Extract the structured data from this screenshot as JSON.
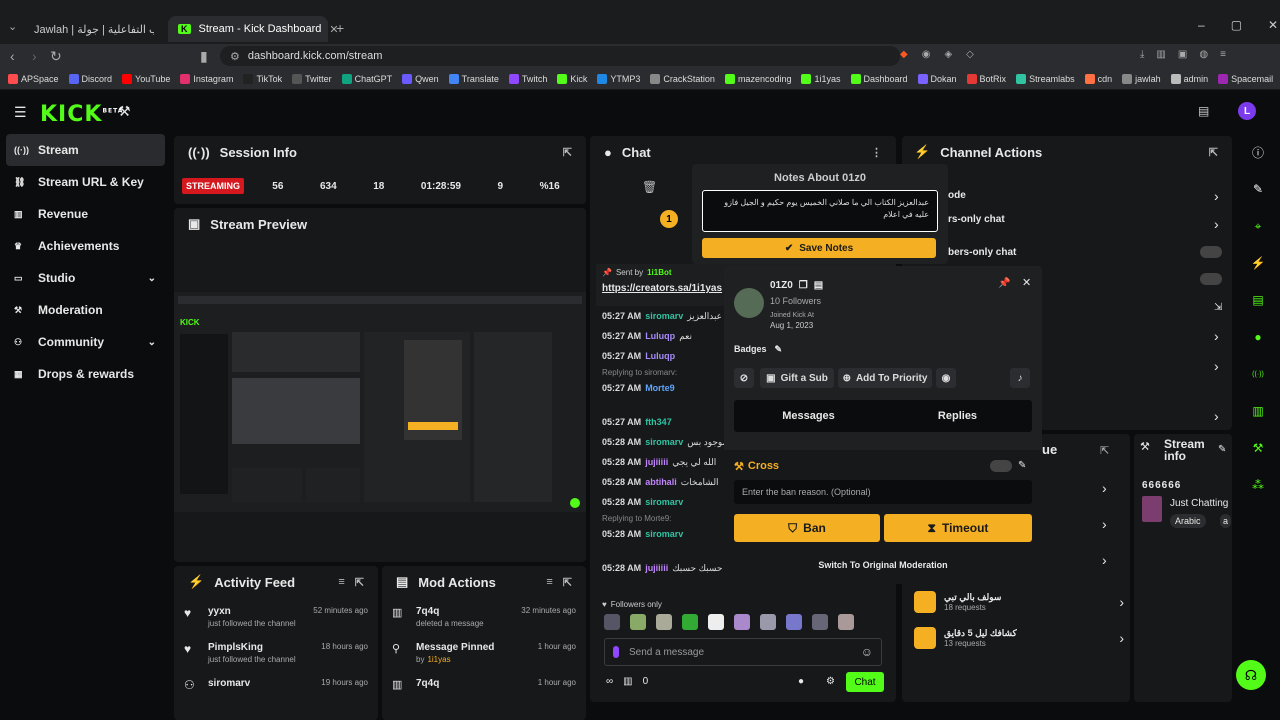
{
  "browser": {
    "tabs": [
      {
        "label": "Jawlah | منصة الألعاب التفاعلية | جولة"
      },
      {
        "label": "Stream - Kick Dashboard"
      }
    ],
    "url": "dashboard.kick.com/stream",
    "bookmarks": [
      "APSpace",
      "Discord",
      "YouTube",
      "Instagram",
      "TikTok",
      "Twitter",
      "ChatGPT",
      "Qwen",
      "Translate",
      "Twitch",
      "Kick",
      "YTMP3",
      "CrackStation",
      "mazencoding",
      "1i1yas",
      "Dashboard",
      "Dokan",
      "BotRix",
      "Streamlabs",
      "cdn",
      "jawlah",
      "admin",
      "Spacemail"
    ],
    "bookmark_colors": [
      "#ff4d4d",
      "#5865f2",
      "#ff0000",
      "#e1306c",
      "#222",
      "#555",
      "#10a37f",
      "#6b5bff",
      "#4285f4",
      "#9146ff",
      "#53fc18",
      "#1e88e5",
      "#888",
      "#53fc18",
      "#53fc18",
      "#53fc18",
      "#7b61ff",
      "#e53935",
      "#31c3a2",
      "#ff7043",
      "#888",
      "#bbb",
      "#9c27b0"
    ]
  },
  "app": {
    "logo": "KICK",
    "logo_sup": "BETA"
  },
  "sidebar": {
    "items": [
      {
        "label": "Stream",
        "icon": "broadcast-icon"
      },
      {
        "label": "Stream URL & Key",
        "icon": "link-icon"
      },
      {
        "label": "Revenue",
        "icon": "chart-icon"
      },
      {
        "label": "Achievements",
        "icon": "trophy-icon"
      },
      {
        "label": "Studio",
        "icon": "tv-icon"
      },
      {
        "label": "Moderation",
        "icon": "hammer-icon"
      },
      {
        "label": "Community",
        "icon": "people-icon"
      },
      {
        "label": "Drops & rewards",
        "icon": "gift-icon"
      }
    ]
  },
  "session": {
    "title": "Session Info",
    "status": "STREAMING",
    "stats": [
      "56",
      "634",
      "18",
      "01:28:59",
      "9",
      "%16"
    ]
  },
  "preview": {
    "title": "Stream Preview"
  },
  "activity": {
    "title": "Activity Feed",
    "items": [
      {
        "user": "yyxn",
        "text": "just followed the channel",
        "time": "52 minutes ago"
      },
      {
        "user": "PimplsKing",
        "text": "just followed the channel",
        "time": "18 hours ago"
      },
      {
        "user": "siromarv",
        "text": "",
        "time": "19 hours ago"
      }
    ]
  },
  "modactions": {
    "title": "Mod Actions",
    "items": [
      {
        "user": "7q4q",
        "text": "deleted a message",
        "time": "32 minutes ago"
      },
      {
        "user": "Message Pinned",
        "by": "by",
        "who": "1i1yas",
        "time": "1 hour ago"
      },
      {
        "user": "7q4q",
        "text": "",
        "time": "1 hour ago"
      }
    ]
  },
  "chat": {
    "title": "Chat",
    "pinned_label": "Sent by",
    "pinned_by": "1i1Bot",
    "pinned_link": "https://creators.sa/1i1yas",
    "messages": [
      {
        "time": "05:27 AM",
        "user": "siromarv",
        "color": "#31c3a2",
        "text": "عبدالعزيز"
      },
      {
        "time": "05:27 AM",
        "user": "Luluqp",
        "color": "#a78bfa",
        "text": "نعم"
      },
      {
        "time": "05:27 AM",
        "user": "Luluqp",
        "color": "#a78bfa",
        "text": ""
      },
      {
        "time": "05:27 AM",
        "user": "Morte9",
        "color": "#60a5fa",
        "text": "",
        "reply": "Replying to siromarv:"
      },
      {
        "time": "05:27 AM",
        "user": "fth347",
        "color": "#31c3a2",
        "text": ""
      },
      {
        "time": "05:28 AM",
        "user": "siromarv",
        "color": "#31c3a2",
        "text": "موجود بس"
      },
      {
        "time": "05:28 AM",
        "user": "jujiiiii",
        "color": "#c084fc",
        "text": "الله لي يجي"
      },
      {
        "time": "05:28 AM",
        "user": "abtihali",
        "color": "#c084fc",
        "text": "الشامخات"
      },
      {
        "time": "05:28 AM",
        "user": "siromarv",
        "color": "#31c3a2",
        "text": ""
      },
      {
        "time": "05:28 AM",
        "user": "siromarv",
        "color": "#31c3a2",
        "text": "",
        "reply": "Replying to Morte9:"
      },
      {
        "time": "05:28 AM",
        "user": "jujiiiii",
        "color": "#c084fc",
        "text": "حسبك حسبك"
      }
    ],
    "followers_only": "Followers only",
    "input_placeholder": "Send a message",
    "send": "Chat",
    "viewers": "0"
  },
  "notes": {
    "title": "Notes About 01z0",
    "text": "عبدالعزيز الكتاب الي ما صلاني الخميس يوم حكيم و الجيل فازو عليه في اعلام",
    "save": "Save Notes"
  },
  "usercard": {
    "name": "01Z0",
    "followers": "10 Followers",
    "joined_label": "Joined Kick At",
    "joined": "Aug 1, 2023",
    "badges": "Badges",
    "gift": "Gift a Sub",
    "priority": "Add To Priority",
    "tab_messages": "Messages",
    "tab_replies": "Replies",
    "cross": "Cross",
    "ban_placeholder": "Enter the ban reason. (Optional)",
    "ban": "Ban",
    "timeout": "Timeout",
    "switch": "Switch To Original Moderation"
  },
  "channel": {
    "title": "Channel Actions",
    "rows": [
      "ode",
      "rs-only chat",
      "bers-only chat"
    ]
  },
  "queue": {
    "title": "ue",
    "items": [
      {
        "label": "سولف بالي تبي",
        "count": "18 requests"
      },
      {
        "label": "كشافك ليل 5 دقايق",
        "count": "13 requests"
      }
    ]
  },
  "streaminfo": {
    "title": "Stream info",
    "code": "666666",
    "category": "Just Chatting",
    "tag": "Arabic",
    "tag2": "a"
  },
  "colors": {
    "accent": "#53fc18",
    "yellow": "#f4b022",
    "red": "#d4181e"
  }
}
